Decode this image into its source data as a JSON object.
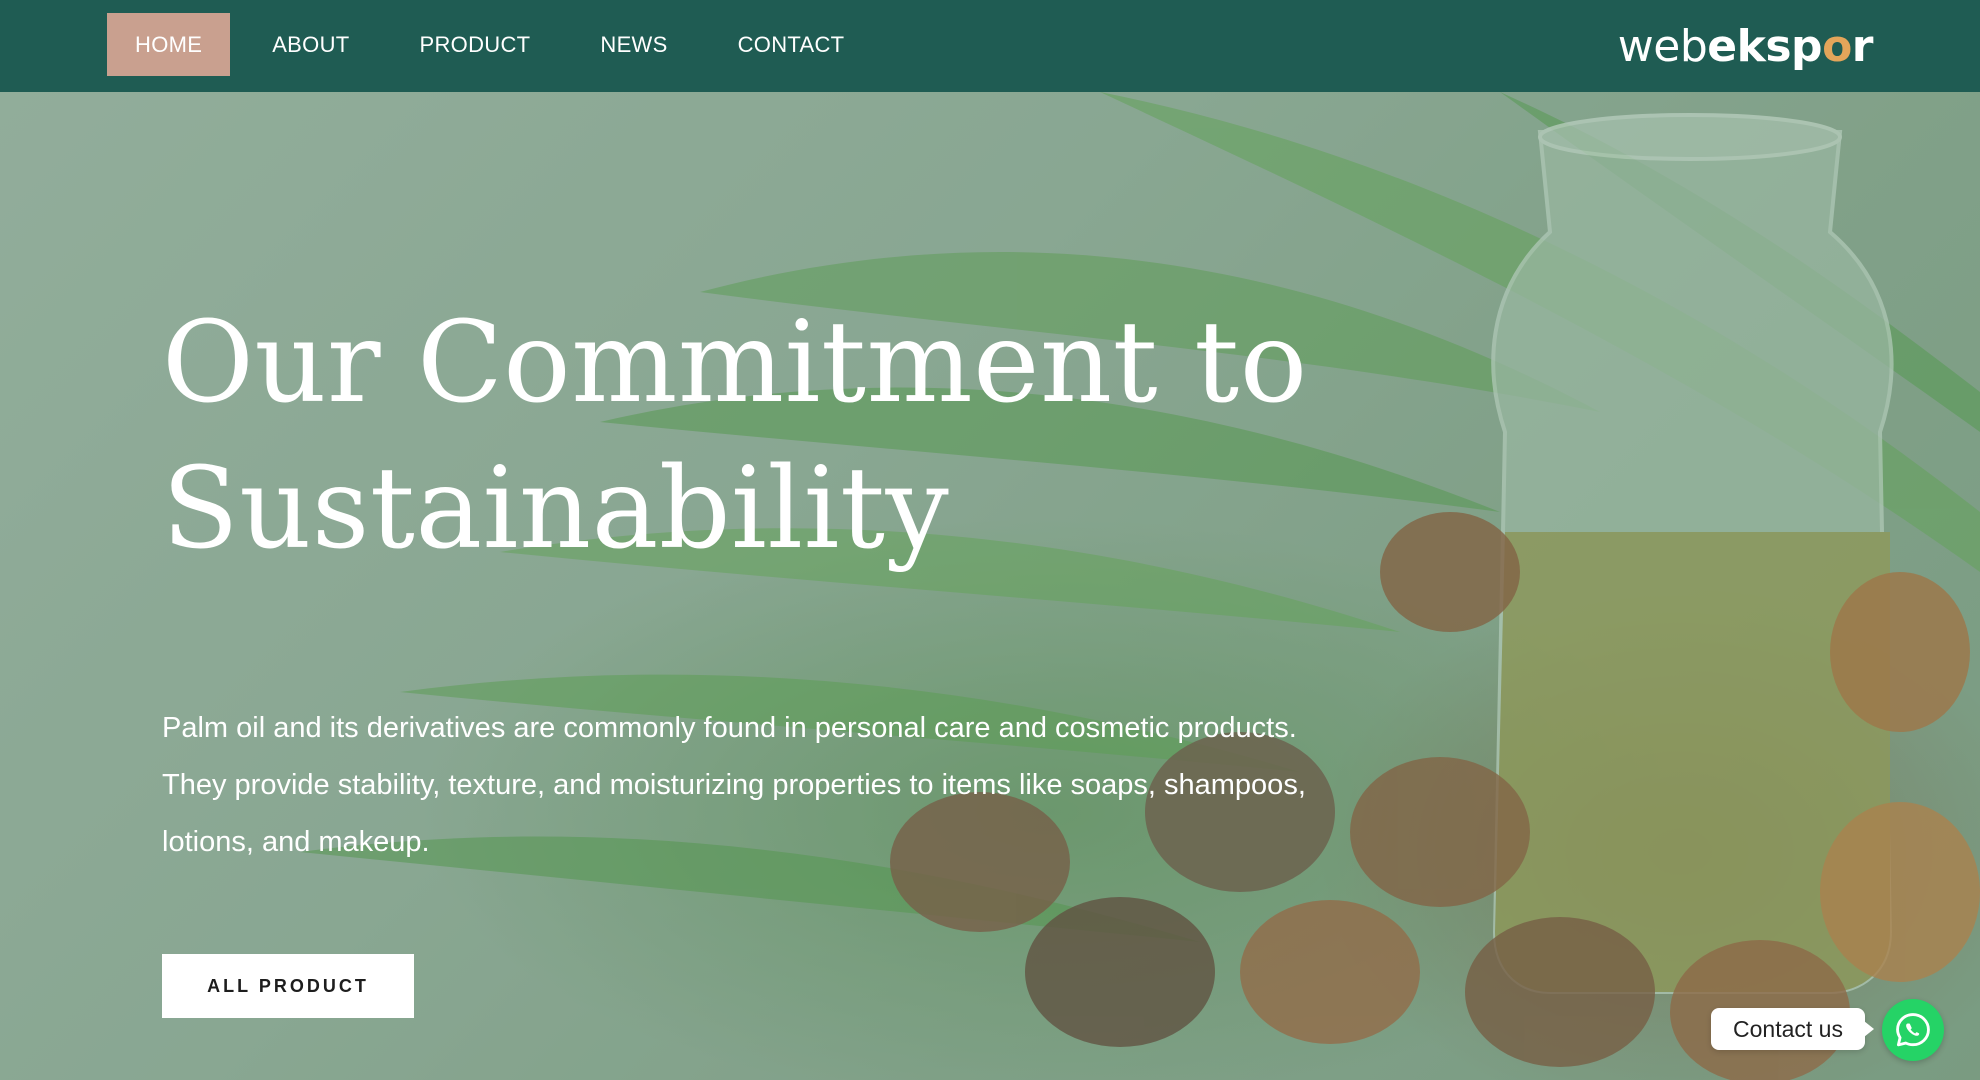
{
  "nav": {
    "items": [
      {
        "label": "HOME",
        "active": true
      },
      {
        "label": "ABOUT",
        "active": false
      },
      {
        "label": "PRODUCT",
        "active": false
      },
      {
        "label": "NEWS",
        "active": false
      },
      {
        "label": "CONTACT",
        "active": false
      }
    ],
    "active_color": "#c9a08f"
  },
  "brand": {
    "part1": "web",
    "part2": "eksp",
    "part3": "o",
    "part4": "r",
    "accent_color": "#e3a55a"
  },
  "hero": {
    "title_line1": "Our Commitment to",
    "title_line2": "Sustainability",
    "description": "Palm oil and its derivatives are commonly found in personal care and cosmetic products. They provide stability, texture, and moisturizing properties to items like soaps, shampoos, lotions, and makeup.",
    "cta_label": "ALL PRODUCT"
  },
  "contact_widget": {
    "label": "Contact us",
    "icon": "whatsapp-icon",
    "color": "#25d366"
  },
  "colors": {
    "header_bg": "#1f5c53",
    "text": "#ffffff"
  }
}
